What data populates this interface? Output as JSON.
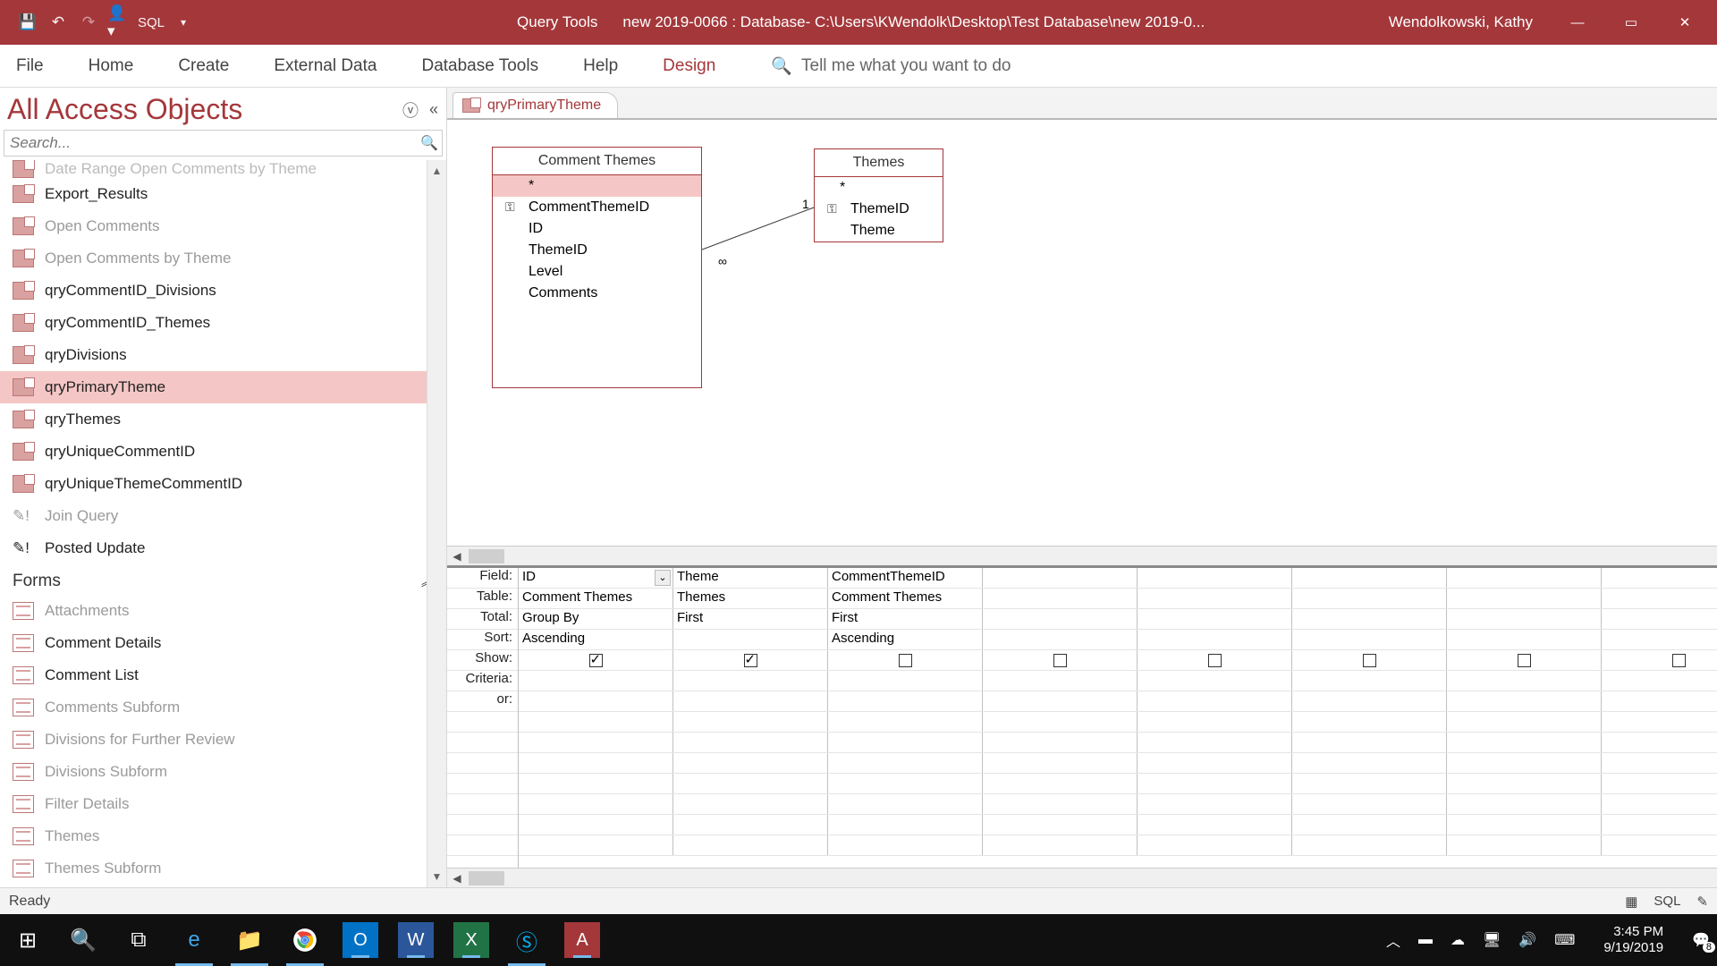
{
  "title": {
    "query_tools": "Query Tools",
    "filename": "new 2019-0066 : Database- C:\\Users\\KWendolk\\Desktop\\Test Database\\new 2019-0...",
    "user": "Wendolkowski, Kathy",
    "sql": "SQL"
  },
  "ribbon": {
    "tabs": [
      "File",
      "Home",
      "Create",
      "External Data",
      "Database Tools",
      "Help",
      "Design"
    ],
    "active": "Design",
    "tellme": "Tell me what you want to do"
  },
  "nav": {
    "title": "All Access Objects",
    "search_placeholder": "Search...",
    "cutoff": "Date Range Open Comments by Theme",
    "items": [
      {
        "label": "Export_Results",
        "type": "q",
        "dim": false
      },
      {
        "label": "Open Comments",
        "type": "q",
        "dim": true
      },
      {
        "label": "Open Comments by Theme",
        "type": "q",
        "dim": true
      },
      {
        "label": "qryCommentID_Divisions",
        "type": "q",
        "dim": false
      },
      {
        "label": "qryCommentID_Themes",
        "type": "q",
        "dim": false
      },
      {
        "label": "qryDivisions",
        "type": "q",
        "dim": false
      },
      {
        "label": "qryPrimaryTheme",
        "type": "q",
        "dim": false,
        "sel": true
      },
      {
        "label": "qryThemes",
        "type": "q",
        "dim": false
      },
      {
        "label": "qryUniqueCommentID",
        "type": "q",
        "dim": false
      },
      {
        "label": "qryUniqueThemeCommentID",
        "type": "q",
        "dim": false
      },
      {
        "label": "Join Query",
        "type": "u",
        "dim": true
      },
      {
        "label": "Posted Update",
        "type": "u",
        "dim": false
      }
    ],
    "forms_header": "Forms",
    "forms": [
      {
        "label": "Attachments",
        "dim": true
      },
      {
        "label": "Comment Details",
        "dim": false
      },
      {
        "label": "Comment List",
        "dim": false
      },
      {
        "label": "Comments Subform",
        "dim": true
      },
      {
        "label": "Divisions for Further Review",
        "dim": true
      },
      {
        "label": "Divisions Subform",
        "dim": true
      },
      {
        "label": "Filter Details",
        "dim": true
      },
      {
        "label": "Themes",
        "dim": true
      },
      {
        "label": "Themes Subform",
        "dim": true
      }
    ]
  },
  "doc": {
    "tab": "qryPrimaryTheme"
  },
  "tables": {
    "t1": {
      "title": "Comment Themes",
      "fields": [
        "*",
        "CommentThemeID",
        "ID",
        "ThemeID",
        "Level",
        "Comments"
      ],
      "key": "CommentThemeID"
    },
    "t2": {
      "title": "Themes",
      "fields": [
        "*",
        "ThemeID",
        "Theme"
      ],
      "key": "ThemeID"
    }
  },
  "join": {
    "left_card": "∞",
    "right_card": "1"
  },
  "grid": {
    "labels": [
      "Field:",
      "Table:",
      "Total:",
      "Sort:",
      "Show:",
      "Criteria:",
      "or:"
    ],
    "cols": [
      {
        "field": "ID",
        "table": "Comment Themes",
        "total": "Group By",
        "sort": "Ascending",
        "show": true
      },
      {
        "field": "Theme",
        "table": "Themes",
        "total": "First",
        "sort": "",
        "show": true
      },
      {
        "field": "CommentThemeID",
        "table": "Comment Themes",
        "total": "First",
        "sort": "Ascending",
        "show": false
      },
      {
        "field": "",
        "table": "",
        "total": "",
        "sort": "",
        "show": false
      },
      {
        "field": "",
        "table": "",
        "total": "",
        "sort": "",
        "show": false
      },
      {
        "field": "",
        "table": "",
        "total": "",
        "sort": "",
        "show": false
      },
      {
        "field": "",
        "table": "",
        "total": "",
        "sort": "",
        "show": false
      },
      {
        "field": "",
        "table": "",
        "total": "",
        "sort": "",
        "show": false
      }
    ]
  },
  "status": {
    "left": "Ready",
    "sql": "SQL"
  },
  "taskbar": {
    "time": "3:45 PM",
    "date": "9/19/2019",
    "badge": "8"
  }
}
